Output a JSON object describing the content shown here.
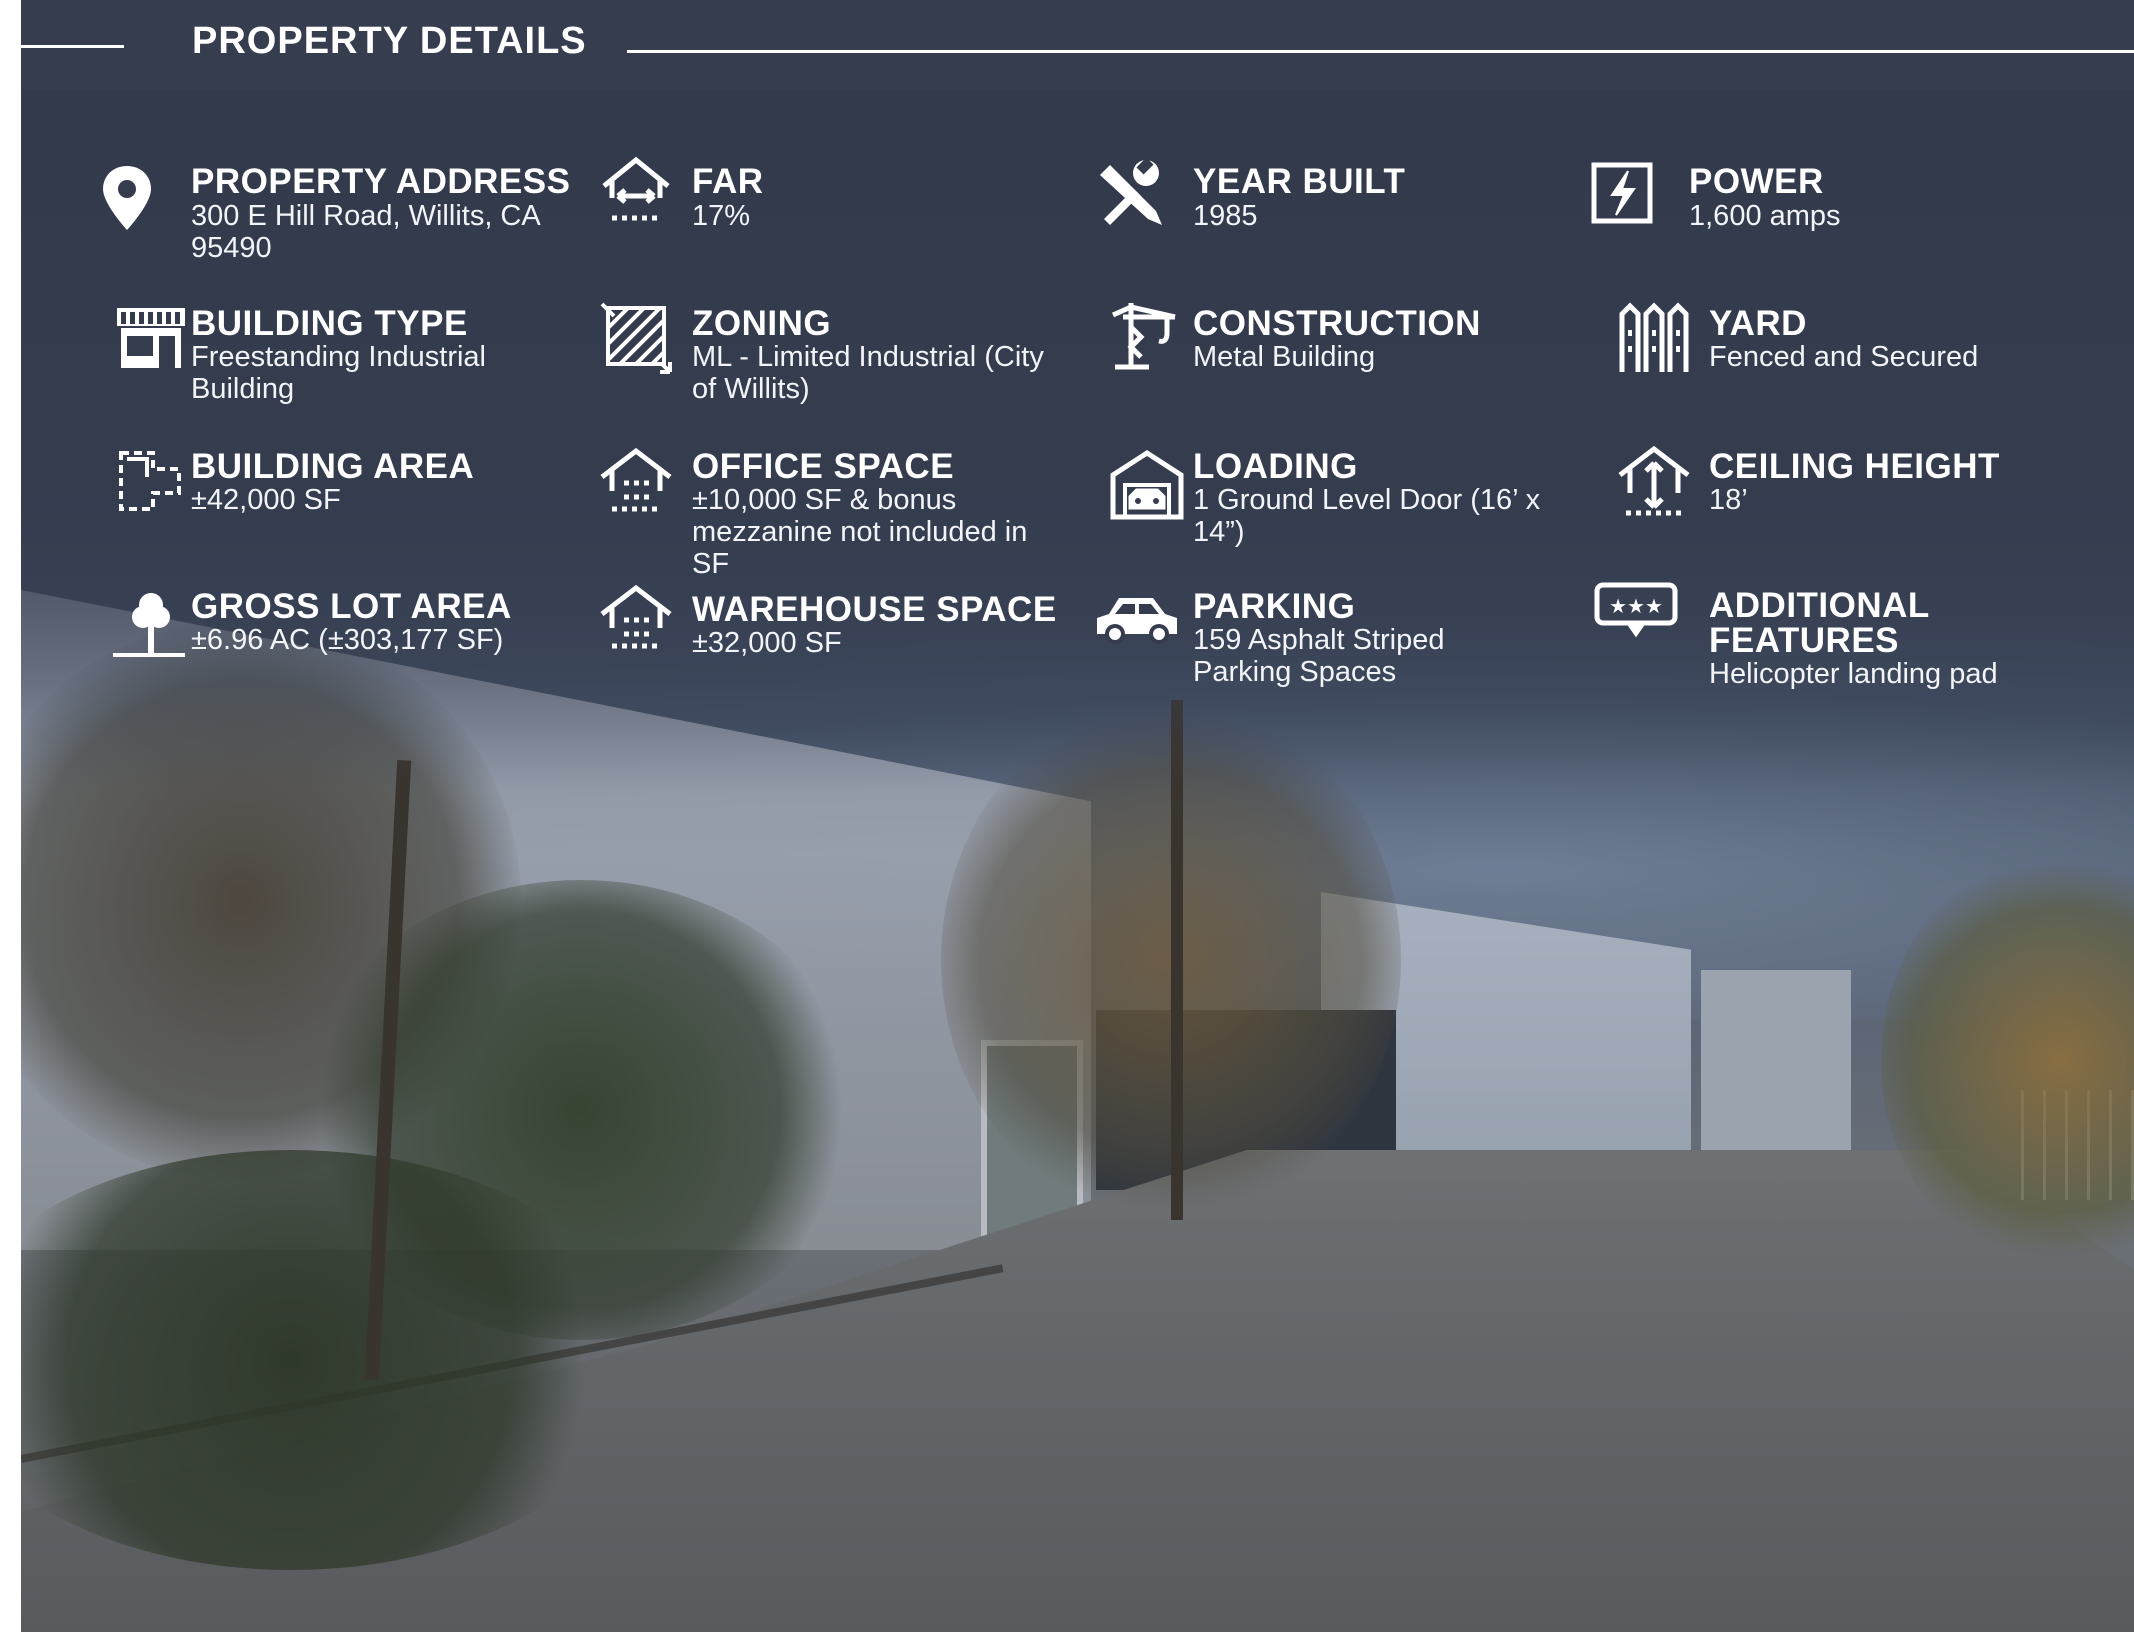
{
  "header": {
    "title": "PROPERTY DETAILS"
  },
  "details": [
    {
      "icon": "map-pin-icon",
      "label": "PROPERTY ADDRESS",
      "value": "300 E Hill Road, Willits, CA 95490"
    },
    {
      "icon": "house-width-icon",
      "label": "FAR",
      "value": "17%"
    },
    {
      "icon": "tools-icon",
      "label": "YEAR BUILT",
      "value": "1985"
    },
    {
      "icon": "power-icon",
      "label": "POWER",
      "value": "1,600 amps"
    },
    {
      "icon": "storefront-icon",
      "label": "BUILDING TYPE",
      "value": "Freestanding Industrial Building"
    },
    {
      "icon": "zoning-icon",
      "label": "ZONING",
      "value": "ML - Limited Industrial (City of Willits)"
    },
    {
      "icon": "crane-icon",
      "label": "CONSTRUCTION",
      "value": "Metal Building"
    },
    {
      "icon": "fence-icon",
      "label": "YARD",
      "value": "Fenced and Secured"
    },
    {
      "icon": "floorplan-icon",
      "label": "BUILDING AREA",
      "value": "±42,000 SF"
    },
    {
      "icon": "house-dotted-icon",
      "label": "OFFICE SPACE",
      "value": "±10,000 SF & bonus mezzanine not included in SF"
    },
    {
      "icon": "garage-icon",
      "label": "LOADING",
      "value": "1 Ground Level Door (16’ x 14”)"
    },
    {
      "icon": "ceiling-height-icon",
      "label": "CEILING HEIGHT",
      "value": "18’"
    },
    {
      "icon": "tree-icon",
      "label": "GROSS LOT AREA",
      "value": "±6.96 AC (±303,177 SF)"
    },
    {
      "icon": "warehouse-icon",
      "label": "WAREHOUSE SPACE",
      "value": "±32,000 SF"
    },
    {
      "icon": "car-icon",
      "label": "PARKING",
      "value": "159 Asphalt Striped Parking Spaces"
    },
    {
      "icon": "message-stars-icon",
      "label": "ADDITIONAL FEATURES",
      "value": "Helicopter landing pad"
    }
  ]
}
